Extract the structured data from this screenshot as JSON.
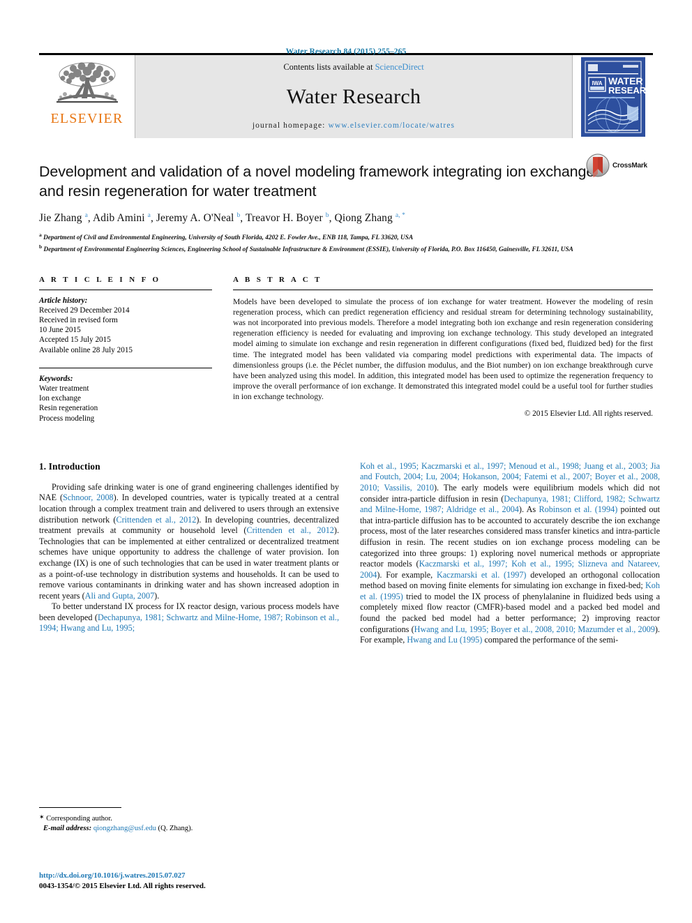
{
  "running_head": "Water Research 84 (2015) 255–265",
  "banner": {
    "publisher_name": "ELSEVIER",
    "contents_prefix": "Contents lists available at ",
    "contents_link": "ScienceDirect",
    "journal_name": "Water Research",
    "homepage_label": "journal homepage: ",
    "homepage_url": "www.elsevier.com/locate/watres",
    "cover_title_line1": "WATER",
    "cover_title_line2": "RESEARCH",
    "cover_badge": "IWA"
  },
  "crossmark": {
    "label": "CrossMark"
  },
  "article": {
    "title": "Development and validation of a novel modeling framework integrating ion exchange and resin regeneration for water treatment",
    "authors": "Jie Zhang a, Adib Amini a, Jeremy A. O'Neal b, Treavor H. Boyer b, Qiong Zhang a, *",
    "affiliation_a": "Department of Civil and Environmental Engineering, University of South Florida, 4202 E. Fowler Ave., ENB 118, Tampa, FL 33620, USA",
    "affiliation_b": "Department of Environmental Engineering Sciences, Engineering School of Sustainable Infrastructure & Environment (ESSIE), University of Florida, P.O. Box 116450, Gainesville, FL 32611, USA"
  },
  "article_info": {
    "heading": "A R T I C L E   I N F O",
    "history_label": "Article history:",
    "history": [
      "Received 29 December 2014",
      "Received in revised form",
      "10 June 2015",
      "Accepted 15 July 2015",
      "Available online 28 July 2015"
    ],
    "keywords_label": "Keywords:",
    "keywords": [
      "Water treatment",
      "Ion exchange",
      "Resin regeneration",
      "Process modeling"
    ]
  },
  "abstract": {
    "heading": "A B S T R A C T",
    "text": "Models have been developed to simulate the process of ion exchange for water treatment. However the modeling of resin regeneration process, which can predict regeneration efficiency and residual stream for determining technology sustainability, was not incorporated into previous models. Therefore a model integrating both ion exchange and resin regeneration considering regeneration efficiency is needed for evaluating and improving ion exchange technology. This study developed an integrated model aiming to simulate ion exchange and resin regeneration in different configurations (fixed bed, fluidized bed) for the first time. The integrated model has been validated via comparing model predictions with experimental data. The impacts of dimensionless groups (i.e. the Péclet number, the diffusion modulus, and the Biot number) on ion exchange breakthrough curve have been analyzed using this model. In addition, this integrated model has been used to optimize the regeneration frequency to improve the overall performance of ion exchange. It demonstrated this integrated model could be a useful tool for further studies in ion exchange technology.",
    "copyright": "© 2015 Elsevier Ltd. All rights reserved."
  },
  "introduction": {
    "section_number_title": "1.  Introduction",
    "left_paragraphs": [
      {
        "segments": [
          {
            "t": "Providing safe drinking water is one of grand engineering challenges identified by NAE (",
            "link": false
          },
          {
            "t": "Schnoor, 2008",
            "link": true
          },
          {
            "t": "). In developed countries, water is typically treated at a central location through a complex treatment train and delivered to users through an extensive distribution network (",
            "link": false
          },
          {
            "t": "Crittenden et al., 2012",
            "link": true
          },
          {
            "t": "). In developing countries, decentralized treatment prevails at community or household level (",
            "link": false
          },
          {
            "t": "Crittenden et al., 2012",
            "link": true
          },
          {
            "t": "). Technologies that can be implemented at either centralized or decentralized treatment schemes have unique opportunity to address the challenge of water provision. Ion exchange (IX) is one of such technologies that can be used in water treatment plants or as a point-of-use technology in distribution systems and households. It can be used to remove various contaminants in drinking water and has shown increased adoption in recent years (",
            "link": false
          },
          {
            "t": "Ali and Gupta, 2007",
            "link": true
          },
          {
            "t": ").",
            "link": false
          }
        ]
      },
      {
        "segments": [
          {
            "t": "To better understand IX process for IX reactor design, various process models have been developed (",
            "link": false
          },
          {
            "t": "Dechapunya, 1981; Schwartz and Milne-Home, 1987; Robinson et al., 1994; Hwang and Lu, 1995;",
            "link": true
          }
        ]
      }
    ],
    "right_paragraphs": [
      {
        "segments": [
          {
            "t": "Koh et al., 1995; Kaczmarski et al., 1997; Menoud et al., 1998; Juang et al., 2003; Jia and Foutch, 2004; Lu, 2004; Hokanson, 2004; Fatemi et al., 2007; Boyer et al., 2008, 2010; Vassilis, 2010",
            "link": true
          },
          {
            "t": "). The early models were equilibrium models which did not consider intra-particle diffusion in resin (",
            "link": false
          },
          {
            "t": "Dechapunya, 1981; Clifford, 1982; Schwartz and Milne-Home, 1987; Aldridge et al., 2004",
            "link": true
          },
          {
            "t": "). As ",
            "link": false
          },
          {
            "t": "Robinson et al. (1994)",
            "link": true
          },
          {
            "t": " pointed out that intra-particle diffusion has to be accounted to accurately describe the ion exchange process, most of the later researches considered mass transfer kinetics and intra-particle diffusion in resin. The recent studies on ion exchange process modeling can be categorized into three groups: 1) exploring novel numerical methods or appropriate reactor models (",
            "link": false
          },
          {
            "t": "Kaczmarski et al., 1997; Koh et al., 1995; Slizneva and Natareev, 2004",
            "link": true
          },
          {
            "t": "). For example, ",
            "link": false
          },
          {
            "t": "Kaczmarski et al. (1997)",
            "link": true
          },
          {
            "t": " developed an orthogonal collocation method based on moving finite elements for simulating ion exchange in fixed-bed; ",
            "link": false
          },
          {
            "t": "Koh et al. (1995)",
            "link": true
          },
          {
            "t": " tried to model the IX process of phenylalanine in fluidized beds using a completely mixed flow reactor (CMFR)-based model and a packed bed model and found the packed bed model had a better performance; 2) improving reactor configurations (",
            "link": false
          },
          {
            "t": "Hwang and Lu, 1995; Boyer et al., 2008, 2010; Mazumder et al., 2009",
            "link": true
          },
          {
            "t": "). For example, ",
            "link": false
          },
          {
            "t": "Hwang and Lu (1995)",
            "link": true
          },
          {
            "t": " compared the performance of the semi-",
            "link": false
          }
        ]
      }
    ]
  },
  "footnote": {
    "corresponding_author": "Corresponding author.",
    "email_label": "E-mail address:",
    "email": "qiongzhang@usf.edu",
    "email_suffix": "(Q. Zhang)."
  },
  "footer": {
    "doi": "http://dx.doi.org/10.1016/j.watres.2015.07.027",
    "issn_line": "0043-1354/© 2015 Elsevier Ltd. All rights reserved."
  },
  "colors": {
    "link": "#2079b5",
    "running_head": "#1b7ba8",
    "elsevier_orange": "#e87613",
    "banner_bg": "#e6e6e6",
    "cover_blue": "#2d4f9e"
  }
}
